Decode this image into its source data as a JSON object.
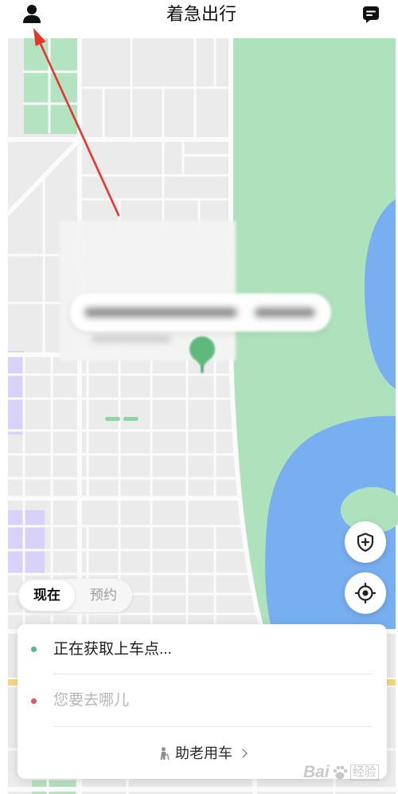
{
  "header": {
    "title": "着急出行",
    "user_icon": "user-icon",
    "message_icon": "message-icon"
  },
  "map_controls": {
    "safety_icon": "shield-plus-icon",
    "locate_icon": "locate-target-icon"
  },
  "mode_tabs": [
    {
      "label": "现在",
      "active": true
    },
    {
      "label": "预约",
      "active": false
    }
  ],
  "trip_card": {
    "pickup": {
      "text": "正在获取上车点...",
      "dot_color": "#4cbd85"
    },
    "destination": {
      "placeholder": "您要去哪儿",
      "dot_color": "#e25567"
    },
    "elderly_service": {
      "label": "助老用车",
      "icon": "elderly-person-icon",
      "chevron_icon": "chevron-right-icon"
    }
  },
  "watermark": {
    "brand": "Bai",
    "product": "经验",
    "icon": "paw-icon"
  },
  "colors": {
    "map_land": "#ebebec",
    "park": "#aee2bc",
    "water": "#78aff1",
    "district": "#d9d1f7",
    "arterial_road": "#f5d97e",
    "pickup_pin": "#5fb97c",
    "annotation_arrow": "#e5352f"
  }
}
